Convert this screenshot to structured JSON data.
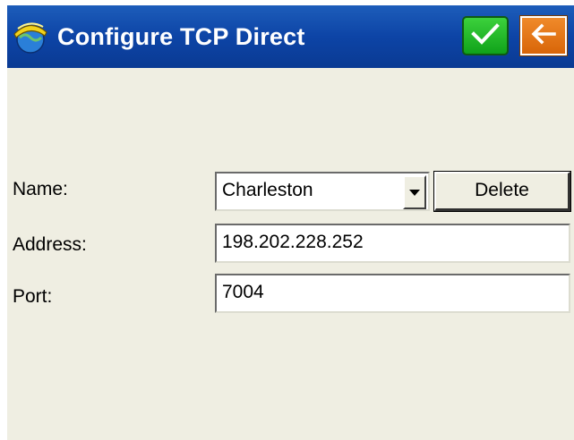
{
  "window": {
    "title": "Configure TCP Direct",
    "app_icon": "hard-hat-globe-icon"
  },
  "titlebar_buttons": {
    "ok_icon": "checkmark-icon",
    "back_icon": "back-arrow-icon"
  },
  "form": {
    "name_label": "Name:",
    "name_value": "Charleston",
    "delete_label": "Delete",
    "address_label": "Address:",
    "address_value": "198.202.228.252",
    "port_label": "Port:",
    "port_value": "7004"
  },
  "colors": {
    "titlebar": "#0d44a6",
    "client_background": "#efeee2",
    "ok_button": "#10a21a",
    "back_button": "#d86508"
  }
}
